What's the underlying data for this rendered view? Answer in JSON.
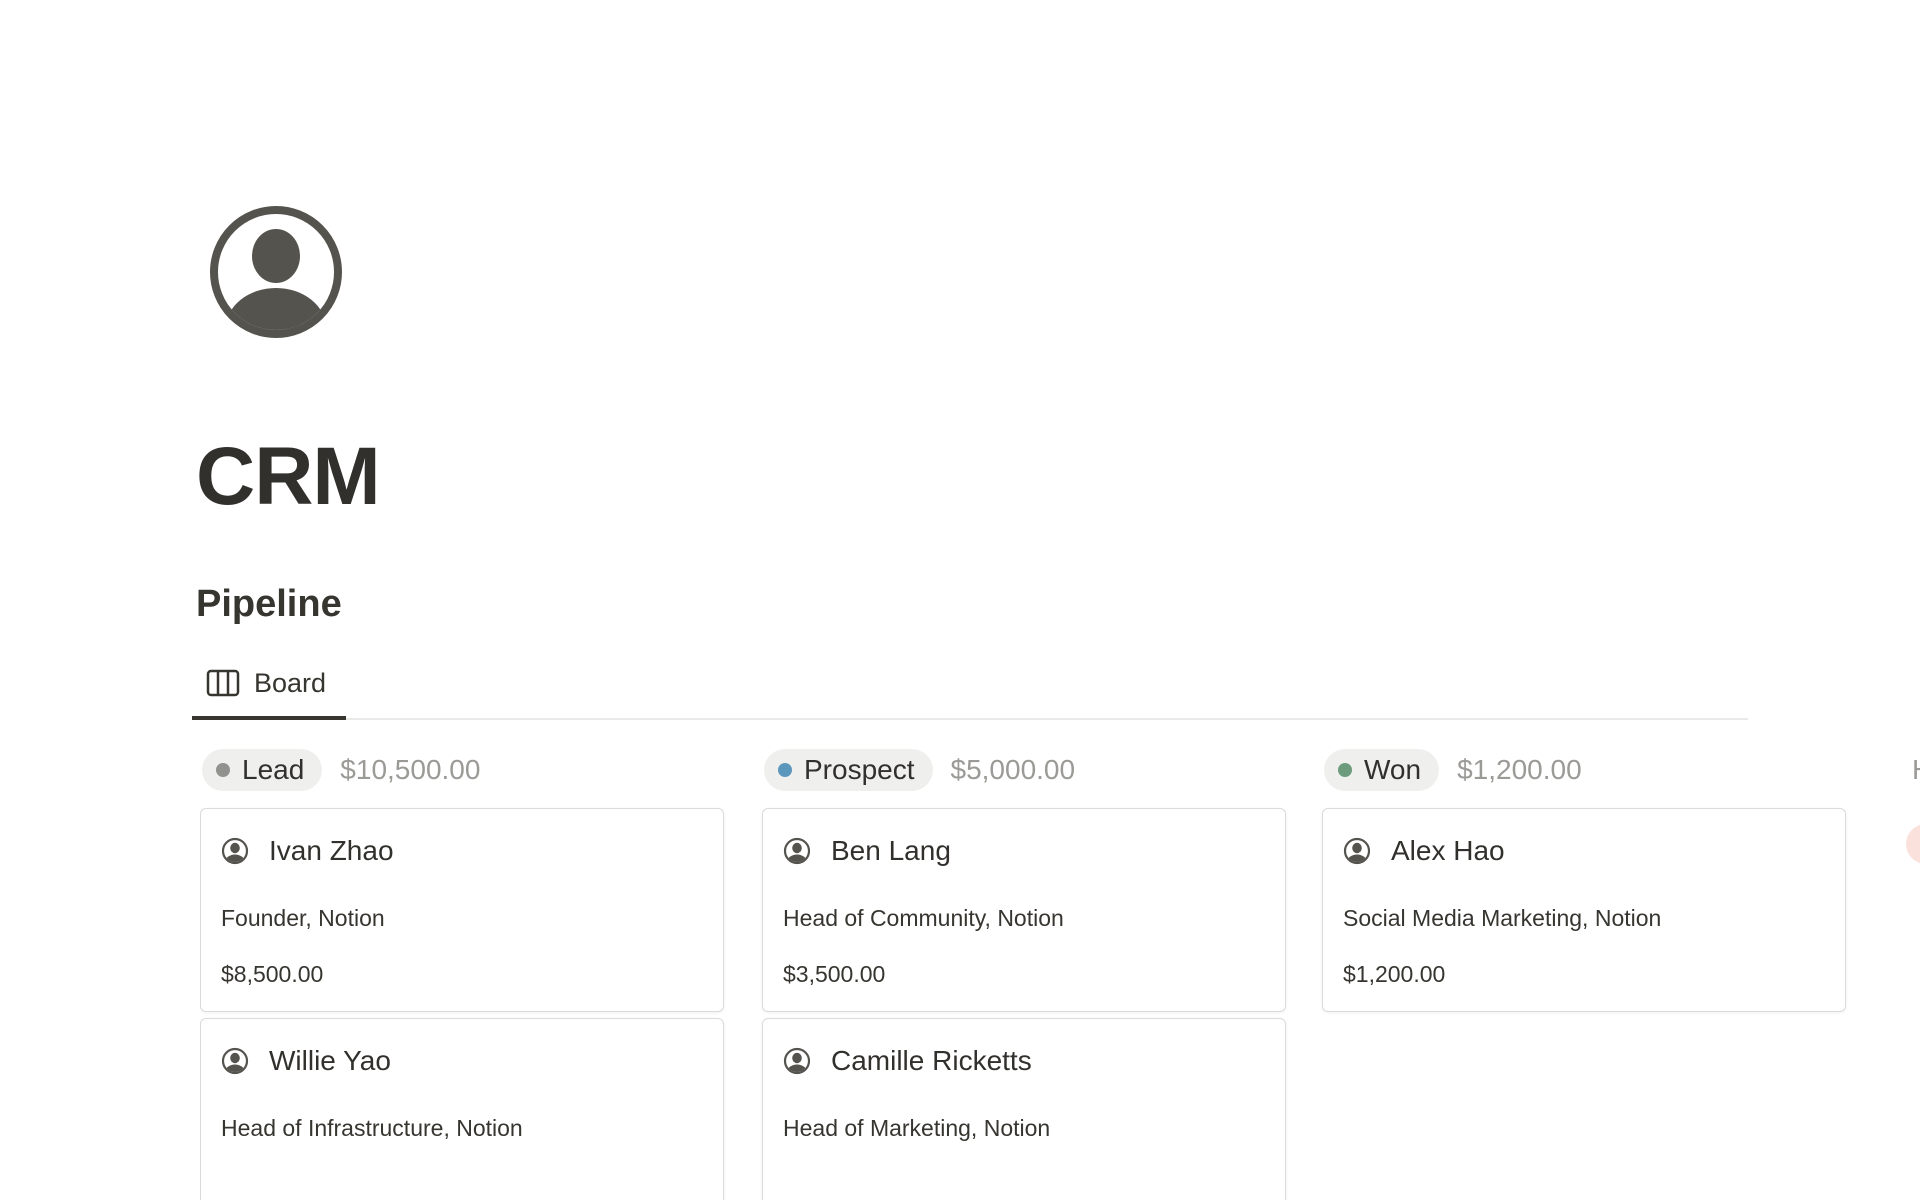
{
  "page": {
    "icon": "person-circle-icon",
    "title": "CRM"
  },
  "database": {
    "title": "Pipeline",
    "views": [
      {
        "label": "Board",
        "icon": "board-view-icon",
        "active": true
      }
    ]
  },
  "board": {
    "columns": [
      {
        "status": "Lead",
        "status_color": "#91918e",
        "pill_bg": "#efefed",
        "sum": "$10,500.00",
        "cards": [
          {
            "name": "Ivan Zhao",
            "role": "Founder, Notion",
            "amount": "$8,500.00"
          },
          {
            "name": "Willie Yao",
            "role": "Head of Infrastructure, Notion",
            "amount": ""
          }
        ]
      },
      {
        "status": "Prospect",
        "status_color": "#5b97bd",
        "pill_bg": "#efefed",
        "sum": "$5,000.00",
        "cards": [
          {
            "name": "Ben Lang",
            "role": "Head of Community, Notion",
            "amount": "$3,500.00"
          },
          {
            "name": "Camille Ricketts",
            "role": "Head of Marketing, Notion",
            "amount": ""
          }
        ]
      },
      {
        "status": "Won",
        "status_color": "#6c9b7d",
        "pill_bg": "#efefed",
        "sum": "$1,200.00",
        "cards": [
          {
            "name": "Alex Hao",
            "role": "Social Media Marketing, Notion",
            "amount": "$1,200.00"
          }
        ]
      }
    ],
    "next_column_peek": "H",
    "next_column_color": "#fbe1dc"
  },
  "colors": {
    "text": "#37352f",
    "muted": "#9b9a97",
    "card_border": "#dcdbd8",
    "icon": "#55534e"
  }
}
